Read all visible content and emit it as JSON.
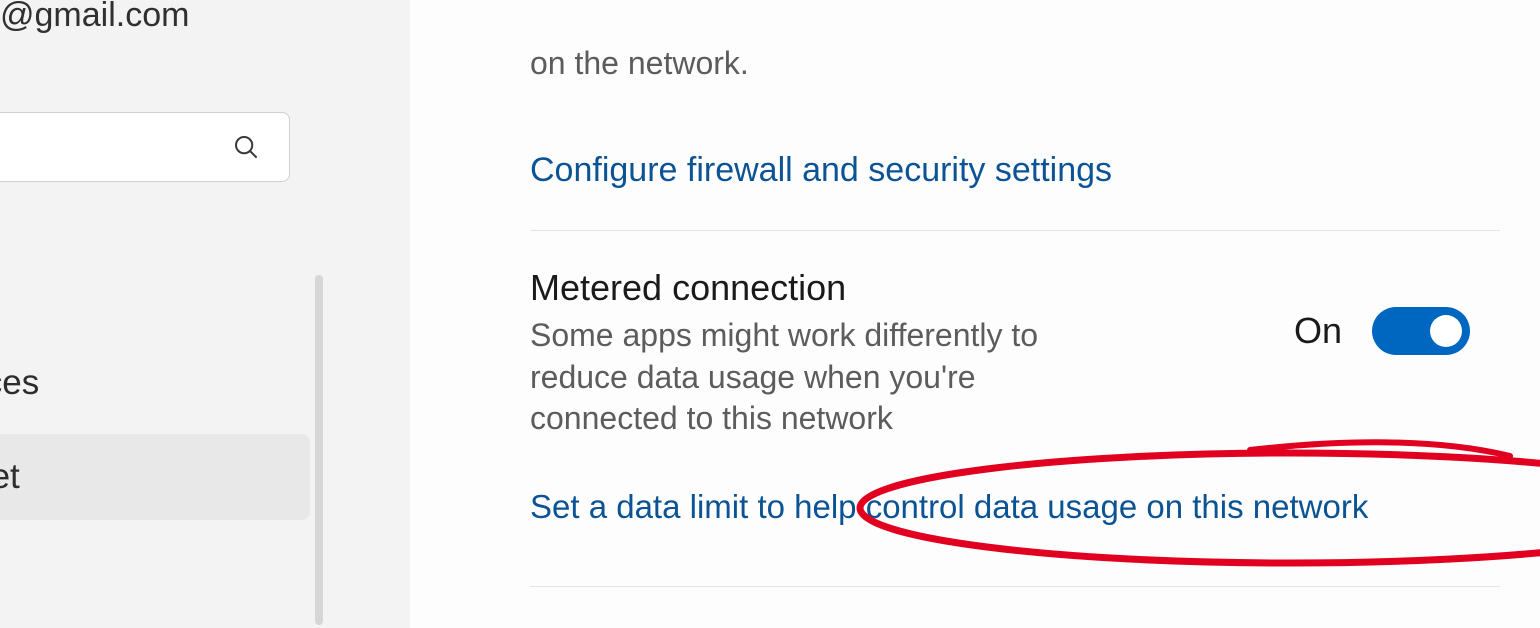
{
  "sidebar": {
    "email": "@gmail.com",
    "items": {
      "devices": "evices",
      "internet": "ernet"
    }
  },
  "main": {
    "section1": {
      "truncated_line": "on the network.",
      "firewall_link": "Configure firewall and security settings"
    },
    "section2": {
      "title": "Metered connection",
      "desc": "Some apps might work differently to reduce data usage when you're connected to this network",
      "toggle_state": "On",
      "data_limit_link": "Set a data limit to help control data usage on this network"
    }
  }
}
